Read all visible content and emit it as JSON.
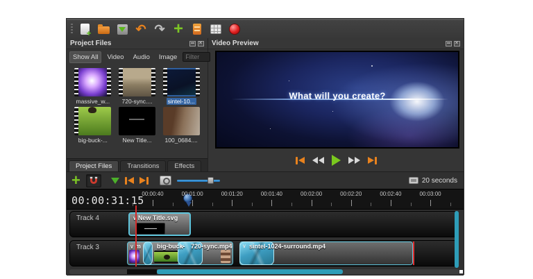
{
  "colors": {
    "accent_orange": "#e8821e",
    "accent_green": "#7dc625",
    "accent_cyan": "#2e9db8",
    "selection_blue": "#3465a4",
    "playhead_red": "#d42a2a",
    "transition_blue": "#3e9ec2"
  },
  "toolbar": {
    "icons": [
      "new-project",
      "open-project",
      "save-project",
      "undo",
      "redo",
      "import-files",
      "choose-profile",
      "fullscreen",
      "export-video"
    ]
  },
  "project_files": {
    "title": "Project Files",
    "filter_tabs": [
      {
        "label": "Show All",
        "active": true
      },
      {
        "label": "Video",
        "active": false
      },
      {
        "label": "Audio",
        "active": false
      },
      {
        "label": "Image",
        "active": false
      }
    ],
    "filter": {
      "placeholder": "Filter"
    },
    "files": [
      {
        "name": "massive_w...",
        "kind": "video",
        "selected": false
      },
      {
        "name": "720-sync....",
        "kind": "video",
        "selected": false
      },
      {
        "name": "sintel-10...",
        "kind": "video",
        "selected": true
      },
      {
        "name": "big-buck-...",
        "kind": "video",
        "selected": false
      },
      {
        "name": "New Title...",
        "kind": "title",
        "selected": false
      },
      {
        "name": "100_0684....",
        "kind": "image",
        "selected": false
      }
    ],
    "dock_tabs": [
      {
        "label": "Project Files",
        "active": true
      },
      {
        "label": "Transitions",
        "active": false
      },
      {
        "label": "Effects",
        "active": false
      }
    ]
  },
  "video_preview": {
    "title": "Video Preview",
    "frame_text": "What will you create?",
    "transport": [
      "jump-to-start",
      "rewind",
      "play",
      "fast-forward",
      "jump-to-end"
    ]
  },
  "timeline": {
    "toolbar_icons": [
      "add-track",
      "snapping-enabled",
      "add-marker",
      "previous-marker",
      "next-marker",
      "zoom",
      "zoom-slider"
    ],
    "scale_label": "20 seconds",
    "timecode": "00:00:31:15",
    "ruler_labels": [
      "00:00:40",
      "00:01:00",
      "00:01:20",
      "00:01:40",
      "00:02:00",
      "00:02:20",
      "00:02:40",
      "00:03:00"
    ],
    "tracks": [
      {
        "name": "Track 4"
      },
      {
        "name": "Track 3"
      }
    ],
    "clips": {
      "title": {
        "label": "New Title.svg"
      },
      "massive": {
        "label": "m"
      },
      "bigbuck": {
        "label": "big-buck-"
      },
      "sync": {
        "label": "720-sync.mp4"
      },
      "sintel": {
        "label": "sintel-1024-surround.mp4"
      }
    }
  }
}
